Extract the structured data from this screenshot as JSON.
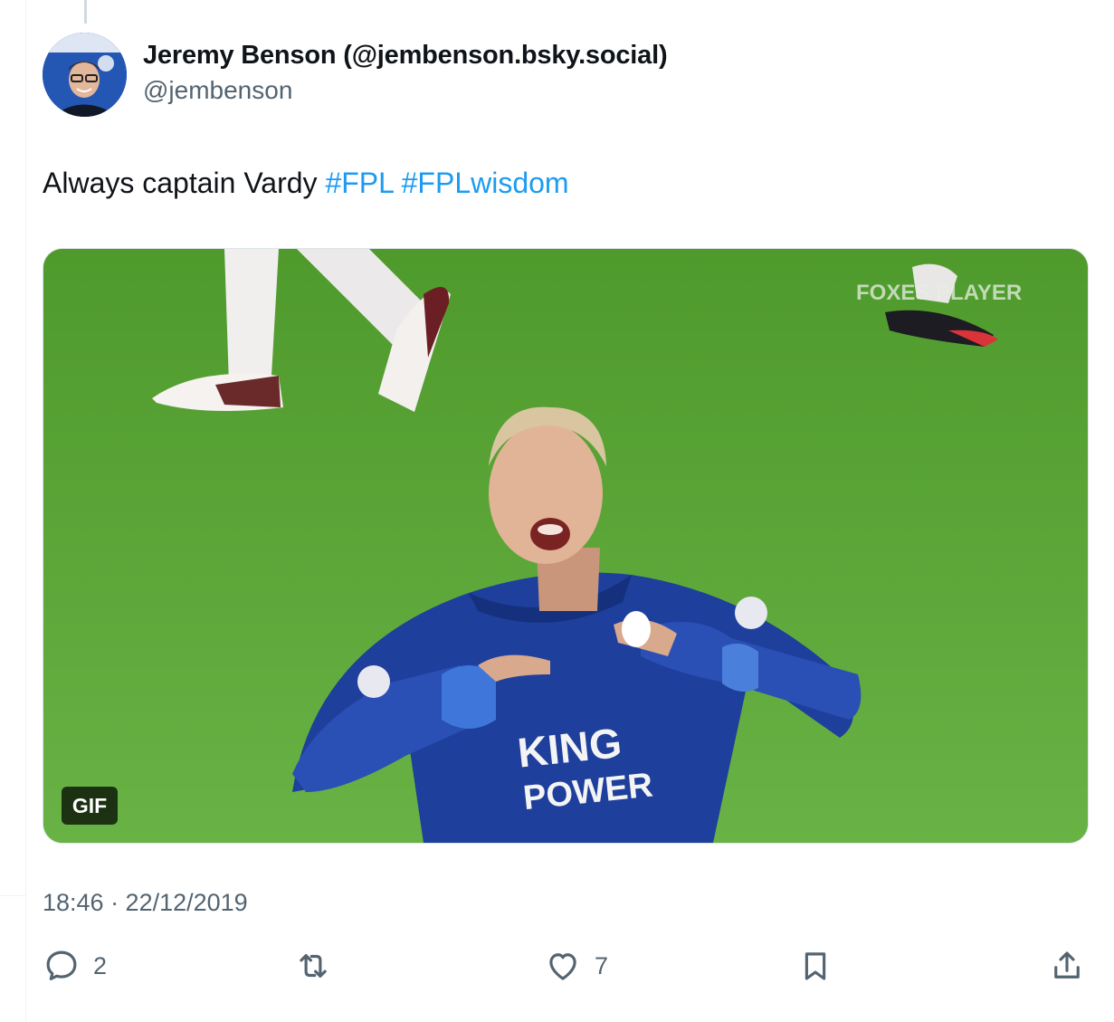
{
  "author": {
    "display_name": "Jeremy Benson (@jembenson.bsky.social)",
    "handle": "@jembenson",
    "avatar_icon": "profile-avatar"
  },
  "tweet": {
    "text_prefix": "Always captain Vardy",
    "hashtags": [
      "#FPL",
      "#FPLwisdom"
    ],
    "hashtag_color": "#1d9bf0"
  },
  "media": {
    "badge": "GIF",
    "jersey_text_line1": "KING",
    "jersey_text_line2": "POWER",
    "watermark": "FOXES PLAYER"
  },
  "timestamp": "18:46 · 22/12/2019",
  "actions": {
    "reply": {
      "icon": "reply-icon",
      "count": "2"
    },
    "retweet": {
      "icon": "retweet-icon",
      "count": ""
    },
    "like": {
      "icon": "heart-icon",
      "count": "7"
    },
    "bookmark": {
      "icon": "bookmark-icon"
    },
    "share": {
      "icon": "share-icon"
    }
  },
  "colors": {
    "text_primary": "#0f1419",
    "text_secondary": "#536471",
    "link": "#1d9bf0"
  }
}
